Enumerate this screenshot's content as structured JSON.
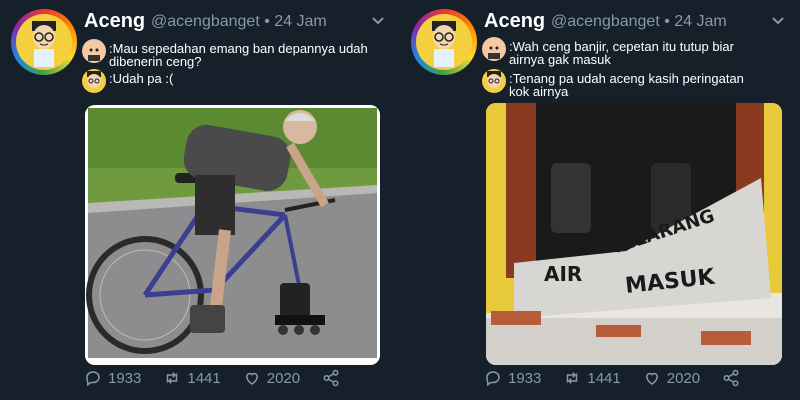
{
  "tweets": [
    {
      "author": {
        "name": "Aceng",
        "handle": "@acengbanget",
        "time": "24 Jam"
      },
      "lines": [
        {
          "speaker": "baby-avatar",
          "text_1": ":Mau sepedahan emang ban depannya udah",
          "text_2": "dibenerin ceng?"
        },
        {
          "speaker": "aceng-avatar",
          "text_1": ":Udah pa :(",
          "text_2": ""
        }
      ],
      "image": {
        "description_icon": "bicycle-rollerskate-photo"
      },
      "stats": {
        "replies": "1933",
        "retweets": "1441",
        "likes": "2020"
      }
    },
    {
      "author": {
        "name": "Aceng",
        "handle": "@acengbanget",
        "time": "24 Jam"
      },
      "lines": [
        {
          "speaker": "baby-avatar",
          "text_1": ":Wah ceng banjir, cepetan itu tutup biar",
          "text_2": "airnya gak masuk"
        },
        {
          "speaker": "aceng-avatar",
          "text_1": ":Tenang pa udah aceng kasih peringatan",
          "text_2": "kok airnya"
        }
      ],
      "image": {
        "graffiti_line_1": "DILARANG",
        "graffiti_line_2": "AIR",
        "graffiti_line_3": "MASUK"
      },
      "stats": {
        "replies": "1933",
        "retweets": "1441",
        "likes": "2020"
      }
    }
  ],
  "colors": {
    "background": "#16202b",
    "muted": "#8899a6",
    "text": "#ffffff"
  }
}
